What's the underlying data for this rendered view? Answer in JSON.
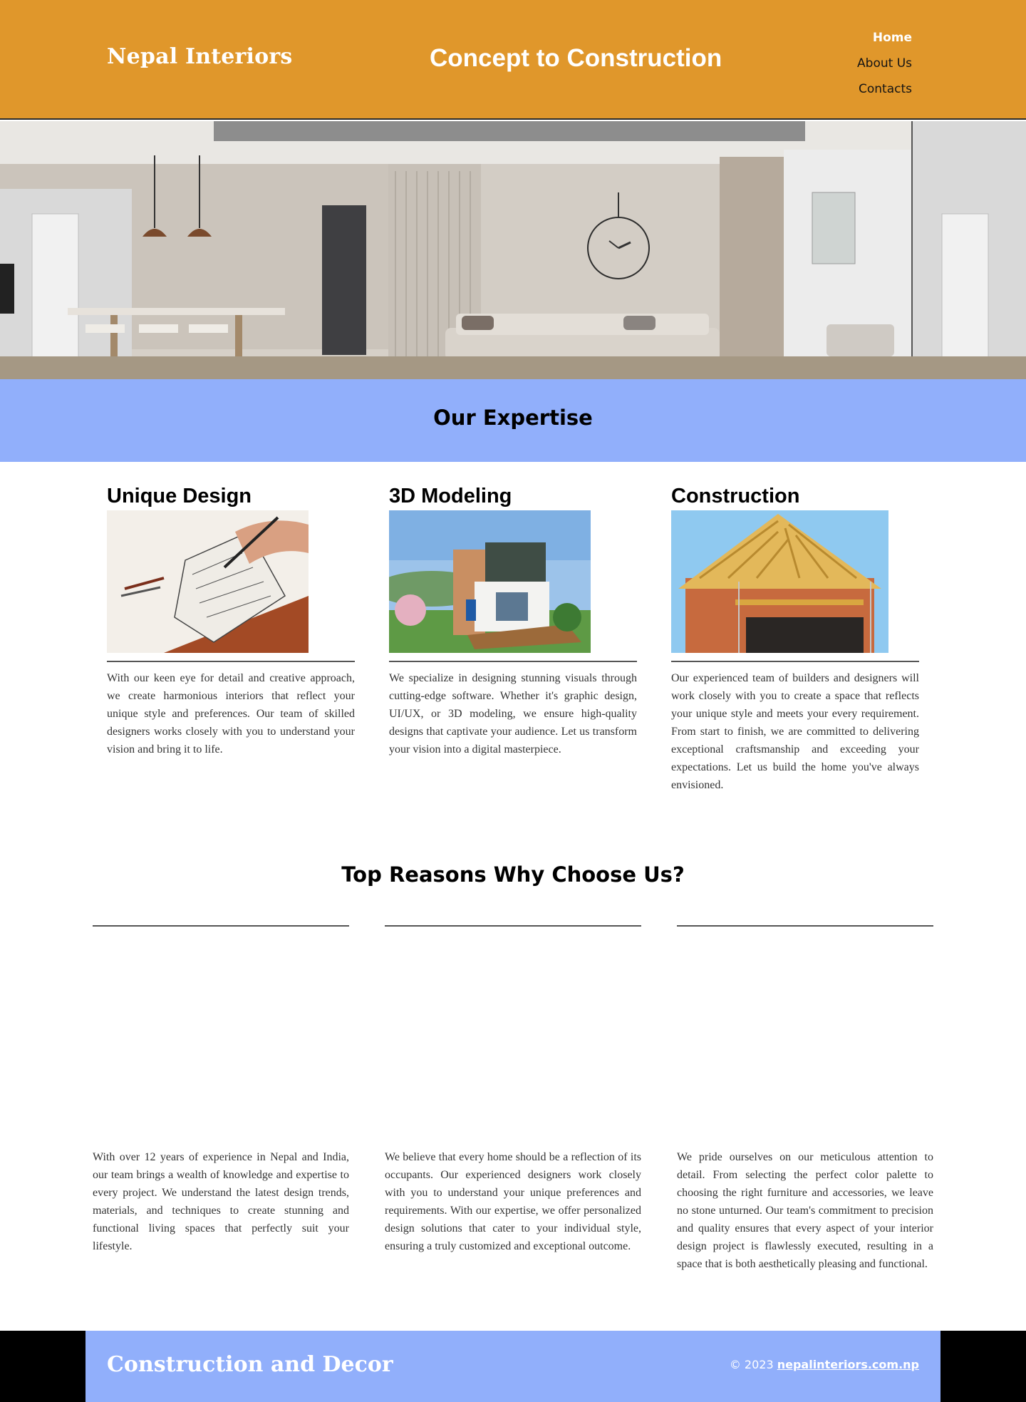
{
  "header": {
    "brand": "Nepal Interiors",
    "tagline": "Concept to Construction",
    "nav": [
      {
        "label": "Home",
        "active": true
      },
      {
        "label": "About Us",
        "active": false
      },
      {
        "label": "Contacts",
        "active": false
      }
    ]
  },
  "expertise": {
    "title": "Our Expertise",
    "cards": [
      {
        "title": "Unique Design",
        "text": "With our keen eye for detail and creative approach, we create harmonious interiors that reflect your unique style and preferences. Our team of skilled designers works closely with you to understand your vision and bring it to life."
      },
      {
        "title": "3D Modeling",
        "text": "We specialize in designing stunning visuals through cutting-edge software. Whether it's graphic design, UI/UX, or 3D modeling, we ensure high-quality designs that captivate your audience. Let us transform your vision into a digital masterpiece."
      },
      {
        "title": "Construction",
        "text": "Our experienced team of builders and designers will work closely with you to create a space that reflects your unique style and meets your every requirement. From start to finish, we are committed to delivering exceptional craftsmanship and exceeding your expectations. Let us build the home you've always envisioned."
      }
    ]
  },
  "reasons": {
    "title": "Top Reasons Why Choose Us?",
    "items": [
      {
        "text": "With over 12 years of experience in Nepal and India, our team brings a wealth of knowledge and expertise to every project. We understand the latest design trends, materials, and techniques to create stunning and functional living spaces that perfectly suit your lifestyle."
      },
      {
        "text": "We believe that every home should be a reflection of its occupants. Our experienced designers work closely with you to understand your unique preferences and requirements. With our expertise, we offer personalized design solutions that cater to your individual style, ensuring a truly customized and exceptional outcome."
      },
      {
        "text": "We pride ourselves on our meticulous attention to detail. From selecting the perfect color palette to choosing the right furniture and accessories, we leave no stone unturned. Our team's commitment to precision and quality ensures that every aspect of your interior design project is flawlessly executed, resulting in a space that is both aesthetically pleasing and functional."
      }
    ]
  },
  "footer": {
    "brand": "Construction and Decor",
    "copyright": "© 2023 ",
    "link": "nepalinteriors.com.np"
  },
  "colors": {
    "header_bg": "#E0972B",
    "band_bg": "#91AFFB",
    "footer_outer": "#000000"
  },
  "images": {
    "hero": "living-room-interior-photo",
    "card1": "hand-sketching-house-drawing",
    "card2": "3d-house-render",
    "card3": "house-under-construction"
  }
}
